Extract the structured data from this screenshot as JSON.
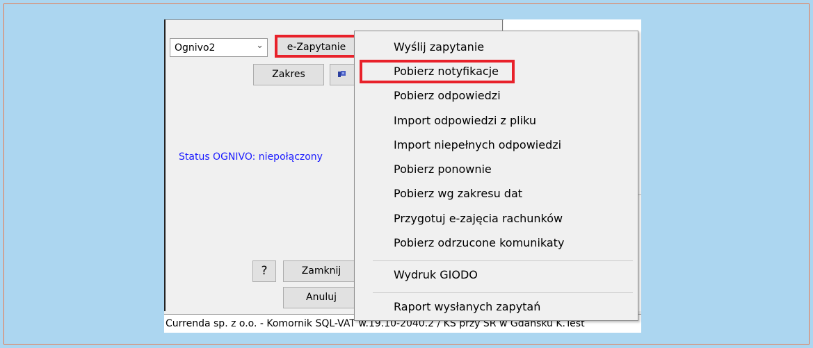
{
  "window": {
    "combo_value": "Ognivo2",
    "ezapytanie_label": "e-Zapytanie",
    "zakres_label": "Zakres",
    "help_label": "?",
    "zamknij_label": "Zamknij",
    "anuluj_label": "Anuluj",
    "status_text": "Status OGNIVO: niepołączony",
    "status_bar_text": "Currenda sp. z o.o. - Komornik SQL-VAT w.19.10-2040.2 / KS przy SR w Gdańsku K.Test"
  },
  "menu": {
    "items": [
      "Wyślij zapytanie",
      "Pobierz notyfikacje",
      "Pobierz odpowiedzi",
      "Import odpowiedzi z pliku",
      "Import niepełnych odpowiedzi",
      "Pobierz ponownie",
      "Pobierz wg zakresu dat",
      "Przygotuj e-zajęcia rachunków",
      "Pobierz odrzucone komunikaty",
      "Wydruk GIODO",
      "Raport wysłanych zapytań"
    ],
    "highlighted_index": 1
  },
  "colors": {
    "highlight": "#e8212a",
    "status_text": "#1a1aff",
    "background": "#acd6f0"
  },
  "icons": {
    "combo_arrow": "chevron-down-icon",
    "flag_button": "flag-icon"
  }
}
